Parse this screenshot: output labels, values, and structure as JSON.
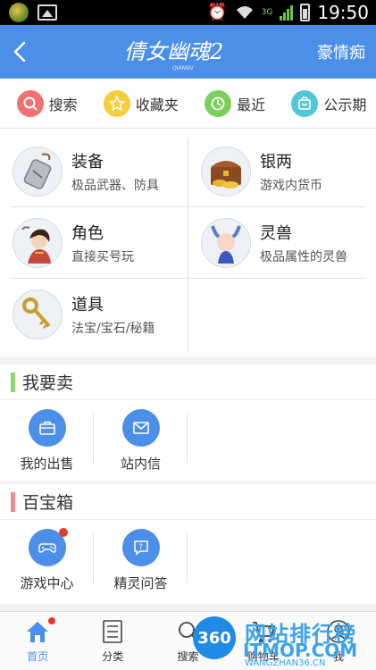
{
  "status_bar": {
    "time": "19:50",
    "network": "3G"
  },
  "header": {
    "logo_text": "倩女幽魂2",
    "logo_sub": "QIANNV",
    "user_name": "豪情痴"
  },
  "quick_nav": [
    {
      "label": "搜索",
      "icon": "search-icon",
      "color": "#f07272"
    },
    {
      "label": "收藏夹",
      "icon": "star-icon",
      "color": "#f5cf3a"
    },
    {
      "label": "最近",
      "icon": "clock-icon",
      "color": "#7ccf5a"
    },
    {
      "label": "公示期",
      "icon": "bag-icon",
      "color": "#52c7d6"
    }
  ],
  "categories": [
    {
      "title": "装备",
      "sub": "极品武器、防具"
    },
    {
      "title": "银两",
      "sub": "游戏内货币"
    },
    {
      "title": "角色",
      "sub": "直接买号玩"
    },
    {
      "title": "灵兽",
      "sub": "极品属性的灵兽"
    },
    {
      "title": "道具",
      "sub": "法宝/宝石/秘籍"
    }
  ],
  "sell_section": {
    "title": "我要卖",
    "bar_color": "#8ed66a",
    "items": [
      {
        "label": "我的出售"
      },
      {
        "label": "站内信"
      }
    ]
  },
  "treasure_section": {
    "title": "百宝箱",
    "bar_color": "#f08c8c",
    "items": [
      {
        "label": "游戏中心"
      },
      {
        "label": "精灵问答"
      }
    ]
  },
  "tab_bar": [
    {
      "label": "首页"
    },
    {
      "label": "分类"
    },
    {
      "label": "搜索"
    },
    {
      "label": "购物车"
    },
    {
      "label": "我"
    }
  ],
  "watermark": {
    "badge": "360",
    "title": "网站排行榜",
    "site": "ITMOP.COM",
    "url": "WANGZHAN36.CN"
  },
  "colors": {
    "brand": "#4b8fe8",
    "badge": "#e8392e"
  }
}
